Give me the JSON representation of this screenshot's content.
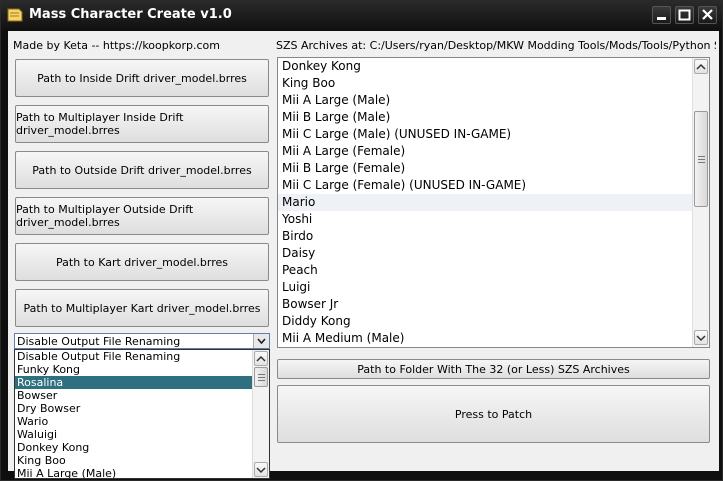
{
  "window": {
    "title": "Mass Character Create v1.0",
    "controls": [
      "minimize-icon",
      "maximize-icon",
      "close-icon"
    ]
  },
  "credit": "Made by Keta -- https://koopkorp.com",
  "szs_path_label": "SZS Archives at: C:/Users/ryan/Desktop/MKW Modding Tools/Mods/Tools/Python Script To",
  "buttons": [
    "Path to Inside Drift driver_model.brres",
    "Path to Multiplayer Inside Drift driver_model.brres",
    "Path to Outside Drift driver_model.brres",
    "Path to Multiplayer Outside Drift driver_model.brres",
    "Path to Kart driver_model.brres",
    "Path to Multiplayer Kart driver_model.brres"
  ],
  "combo": {
    "value": "Disable Output File Renaming",
    "options_visible": [
      "Disable Output File Renaming",
      "Funky Kong",
      "Rosalina",
      "Bowser",
      "Dry Bowser",
      "Wario",
      "Waluigi",
      "Donkey Kong",
      "King Boo",
      "Mii A Large (Male)"
    ],
    "highlighted": "Rosalina"
  },
  "archive_list": {
    "items": [
      "Donkey Kong",
      "King Boo",
      "Mii A Large (Male)",
      "Mii B Large (Male)",
      "Mii C Large (Male) (UNUSED IN-GAME)",
      "Mii A Large (Female)",
      "Mii B Large (Female)",
      "Mii C Large (Female) (UNUSED IN-GAME)",
      "Mario",
      "Yoshi",
      "Birdo",
      "Daisy",
      "Peach",
      "Luigi",
      "Bowser Jr",
      "Diddy Kong",
      "Mii A Medium (Male)"
    ],
    "hovered": "Mario"
  },
  "folder_button": "Path to Folder With The 32 (or Less) SZS Archives",
  "patch_button": "Press to Patch"
}
